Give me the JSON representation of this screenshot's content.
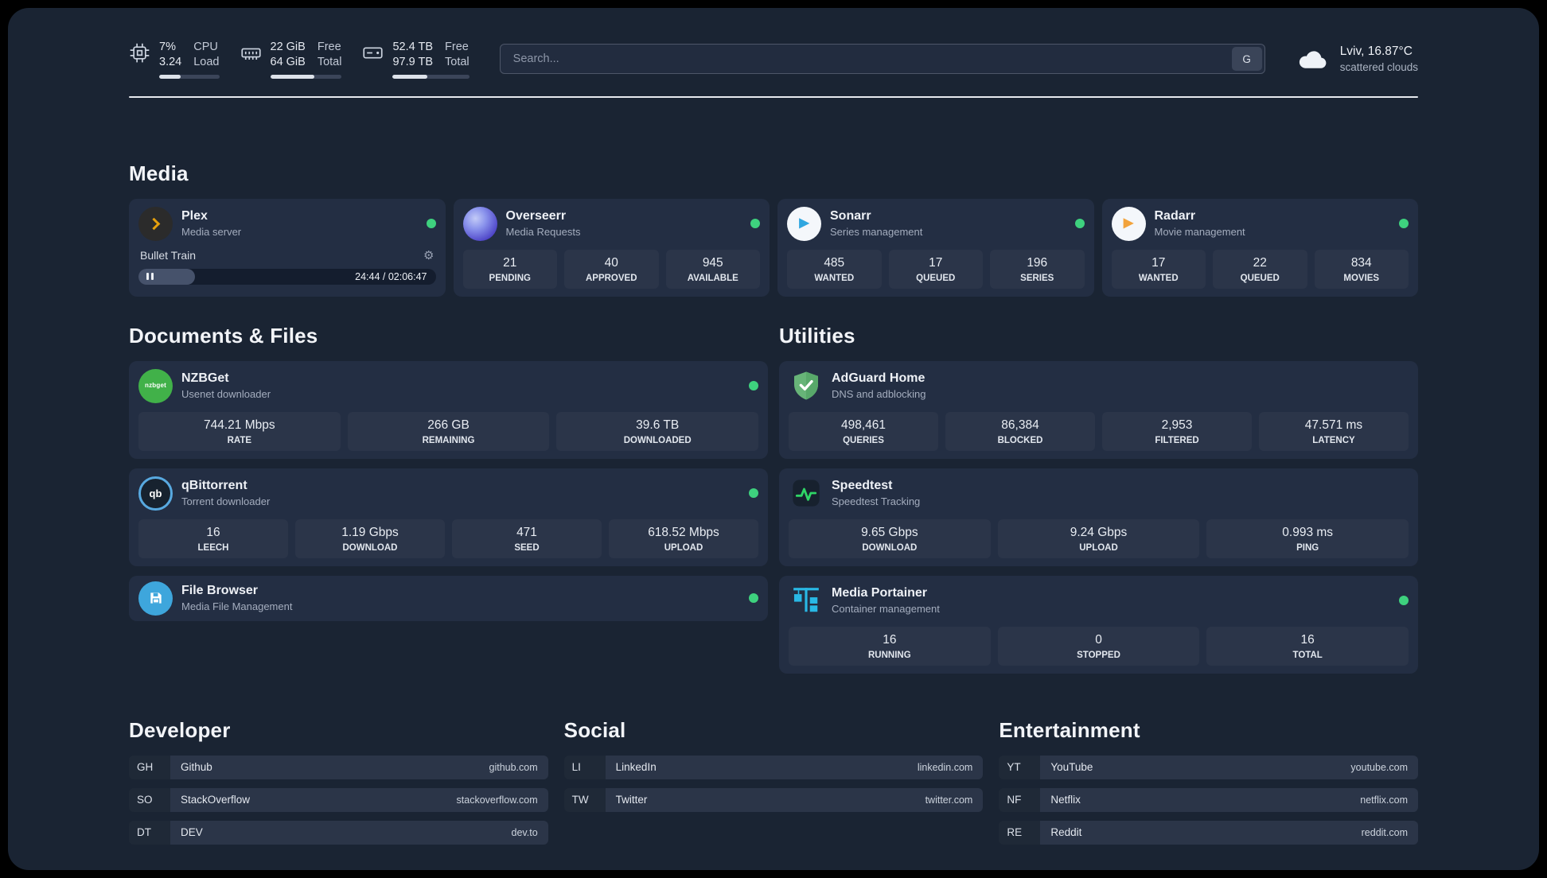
{
  "topbar": {
    "cpu": {
      "value1": "7%",
      "value2": "3.24",
      "label1": "CPU",
      "label2": "Load",
      "bar": "36%"
    },
    "memory": {
      "value1": "22 GiB",
      "value2": "64 GiB",
      "label1": "Free",
      "label2": "Total",
      "bar": "62%"
    },
    "disk": {
      "value1": "52.4 TB",
      "value2": "97.9 TB",
      "label1": "Free",
      "label2": "Total",
      "bar": "45%"
    },
    "search": {
      "placeholder": "Search...",
      "button": "G"
    },
    "weather": {
      "location": "Lviv, 16.87°C",
      "condition": "scattered clouds"
    }
  },
  "sections": {
    "media": "Media",
    "documents": "Documents & Files",
    "utilities": "Utilities"
  },
  "media": {
    "plex": {
      "name": "Plex",
      "subtitle": "Media server",
      "now_playing": "Bullet Train",
      "time": "24:44 / 02:06:47",
      "progress": "19%"
    },
    "overseerr": {
      "name": "Overseerr",
      "subtitle": "Media Requests",
      "stats": [
        {
          "value": "21",
          "label": "PENDING"
        },
        {
          "value": "40",
          "label": "APPROVED"
        },
        {
          "value": "945",
          "label": "AVAILABLE"
        }
      ]
    },
    "sonarr": {
      "name": "Sonarr",
      "subtitle": "Series management",
      "stats": [
        {
          "value": "485",
          "label": "WANTED"
        },
        {
          "value": "17",
          "label": "QUEUED"
        },
        {
          "value": "196",
          "label": "SERIES"
        }
      ]
    },
    "radarr": {
      "name": "Radarr",
      "subtitle": "Movie management",
      "stats": [
        {
          "value": "17",
          "label": "WANTED"
        },
        {
          "value": "22",
          "label": "QUEUED"
        },
        {
          "value": "834",
          "label": "MOVIES"
        }
      ]
    }
  },
  "documents": {
    "nzbget": {
      "name": "NZBGet",
      "subtitle": "Usenet downloader",
      "stats": [
        {
          "value": "744.21 Mbps",
          "label": "RATE"
        },
        {
          "value": "266 GB",
          "label": "REMAINING"
        },
        {
          "value": "39.6 TB",
          "label": "DOWNLOADED"
        }
      ]
    },
    "qbittorrent": {
      "name": "qBittorrent",
      "subtitle": "Torrent downloader",
      "stats": [
        {
          "value": "16",
          "label": "LEECH"
        },
        {
          "value": "1.19 Gbps",
          "label": "DOWNLOAD"
        },
        {
          "value": "471",
          "label": "SEED"
        },
        {
          "value": "618.52 Mbps",
          "label": "UPLOAD"
        }
      ]
    },
    "filebrowser": {
      "name": "File Browser",
      "subtitle": "Media File Management"
    }
  },
  "utilities": {
    "adguard": {
      "name": "AdGuard Home",
      "subtitle": "DNS and adblocking",
      "stats": [
        {
          "value": "498,461",
          "label": "QUERIES"
        },
        {
          "value": "86,384",
          "label": "BLOCKED"
        },
        {
          "value": "2,953",
          "label": "FILTERED"
        },
        {
          "value": "47.571 ms",
          "label": "LATENCY"
        }
      ]
    },
    "speedtest": {
      "name": "Speedtest",
      "subtitle": "Speedtest Tracking",
      "stats": [
        {
          "value": "9.65 Gbps",
          "label": "DOWNLOAD"
        },
        {
          "value": "9.24 Gbps",
          "label": "UPLOAD"
        },
        {
          "value": "0.993 ms",
          "label": "PING"
        }
      ]
    },
    "portainer": {
      "name": "Media Portainer",
      "subtitle": "Container management",
      "stats": [
        {
          "value": "16",
          "label": "RUNNING"
        },
        {
          "value": "0",
          "label": "STOPPED"
        },
        {
          "value": "16",
          "label": "TOTAL"
        }
      ]
    }
  },
  "bookmarks": {
    "developer": {
      "title": "Developer",
      "items": [
        {
          "abbr": "GH",
          "name": "Github",
          "domain": "github.com"
        },
        {
          "abbr": "SO",
          "name": "StackOverflow",
          "domain": "stackoverflow.com"
        },
        {
          "abbr": "DT",
          "name": "DEV",
          "domain": "dev.to"
        }
      ]
    },
    "social": {
      "title": "Social",
      "items": [
        {
          "abbr": "LI",
          "name": "LinkedIn",
          "domain": "linkedin.com"
        },
        {
          "abbr": "TW",
          "name": "Twitter",
          "domain": "twitter.com"
        }
      ]
    },
    "entertainment": {
      "title": "Entertainment",
      "items": [
        {
          "abbr": "YT",
          "name": "YouTube",
          "domain": "youtube.com"
        },
        {
          "abbr": "NF",
          "name": "Netflix",
          "domain": "netflix.com"
        },
        {
          "abbr": "RE",
          "name": "Reddit",
          "domain": "reddit.com"
        }
      ]
    }
  },
  "icons": {
    "gear": "⚙",
    "play": "▶",
    "qb": "qb",
    "nzbget": "nzbget"
  },
  "colors": {
    "status_green": "#3ed17e",
    "plex_amber": "#e5a00d"
  }
}
